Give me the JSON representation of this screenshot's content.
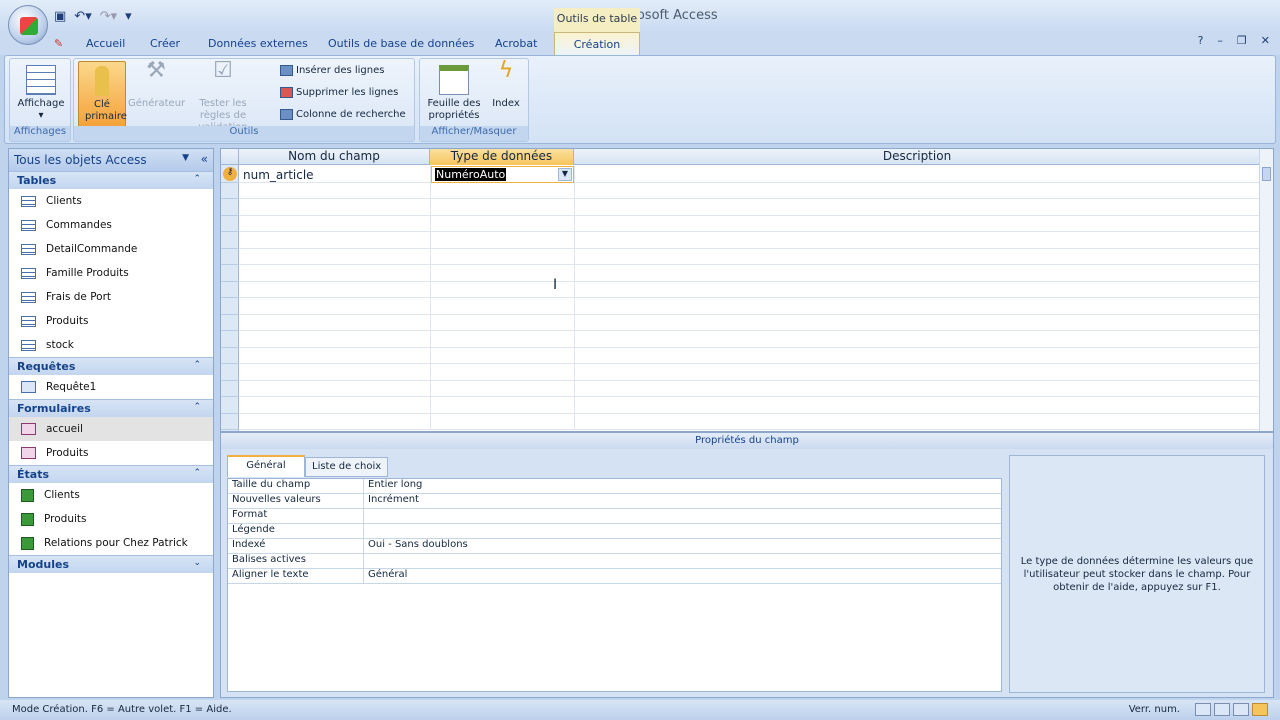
{
  "window": {
    "title": "stock - Microsoft Access",
    "context_title": "Outils de table"
  },
  "tabs": [
    "Accueil",
    "Créer",
    "Données externes",
    "Outils de base de données",
    "Acrobat",
    "Création"
  ],
  "ribbon": {
    "affichages": {
      "label": "Affichages",
      "button": "Affichage"
    },
    "outils": {
      "label": "Outils",
      "cle": "Clé primaire",
      "generateur": "Générateur",
      "tester": "Tester les règles de validation",
      "inserer": "Insérer des lignes",
      "supprimer": "Supprimer les lignes",
      "colonne": "Colonne de recherche"
    },
    "afficher": {
      "label": "Afficher/Masquer",
      "feuille": "Feuille des propriétés",
      "index": "Index"
    }
  },
  "nav": {
    "title": "Tous les objets Access",
    "sections": [
      {
        "label": "Tables",
        "items": [
          "Clients",
          "Commandes",
          "DetailCommande",
          "Famille Produits",
          "Frais de Port",
          "Produits",
          "stock"
        ]
      },
      {
        "label": "Requêtes",
        "items": [
          "Requête1"
        ]
      },
      {
        "label": "Formulaires",
        "items": [
          "accueil",
          "Produits"
        ]
      },
      {
        "label": "États",
        "items": [
          "Clients",
          "Produits",
          "Relations pour Chez Patrick"
        ]
      },
      {
        "label": "Modules",
        "items": []
      }
    ]
  },
  "grid": {
    "headers": [
      "Nom du champ",
      "Type de données",
      "Description"
    ],
    "rows": [
      {
        "name": "num_article",
        "type": "NuméroAuto",
        "description": ""
      }
    ]
  },
  "props": {
    "title": "Propriétés du champ",
    "tabs": [
      "Général",
      "Liste de choix"
    ],
    "rows": [
      [
        "Taille du champ",
        "Entier long"
      ],
      [
        "Nouvelles valeurs",
        "Incrément"
      ],
      [
        "Format",
        ""
      ],
      [
        "Légende",
        ""
      ],
      [
        "Indexé",
        "Oui - Sans doublons"
      ],
      [
        "Balises actives",
        ""
      ],
      [
        "Aligner le texte",
        "Général"
      ]
    ],
    "help": "Le type de données détermine les valeurs que l'utilisateur peut stocker dans le champ. Pour obtenir de l'aide, appuyez sur F1."
  },
  "status": {
    "left": "Mode Création. F6 = Autre volet. F1 = Aide.",
    "right": "Verr. num."
  }
}
